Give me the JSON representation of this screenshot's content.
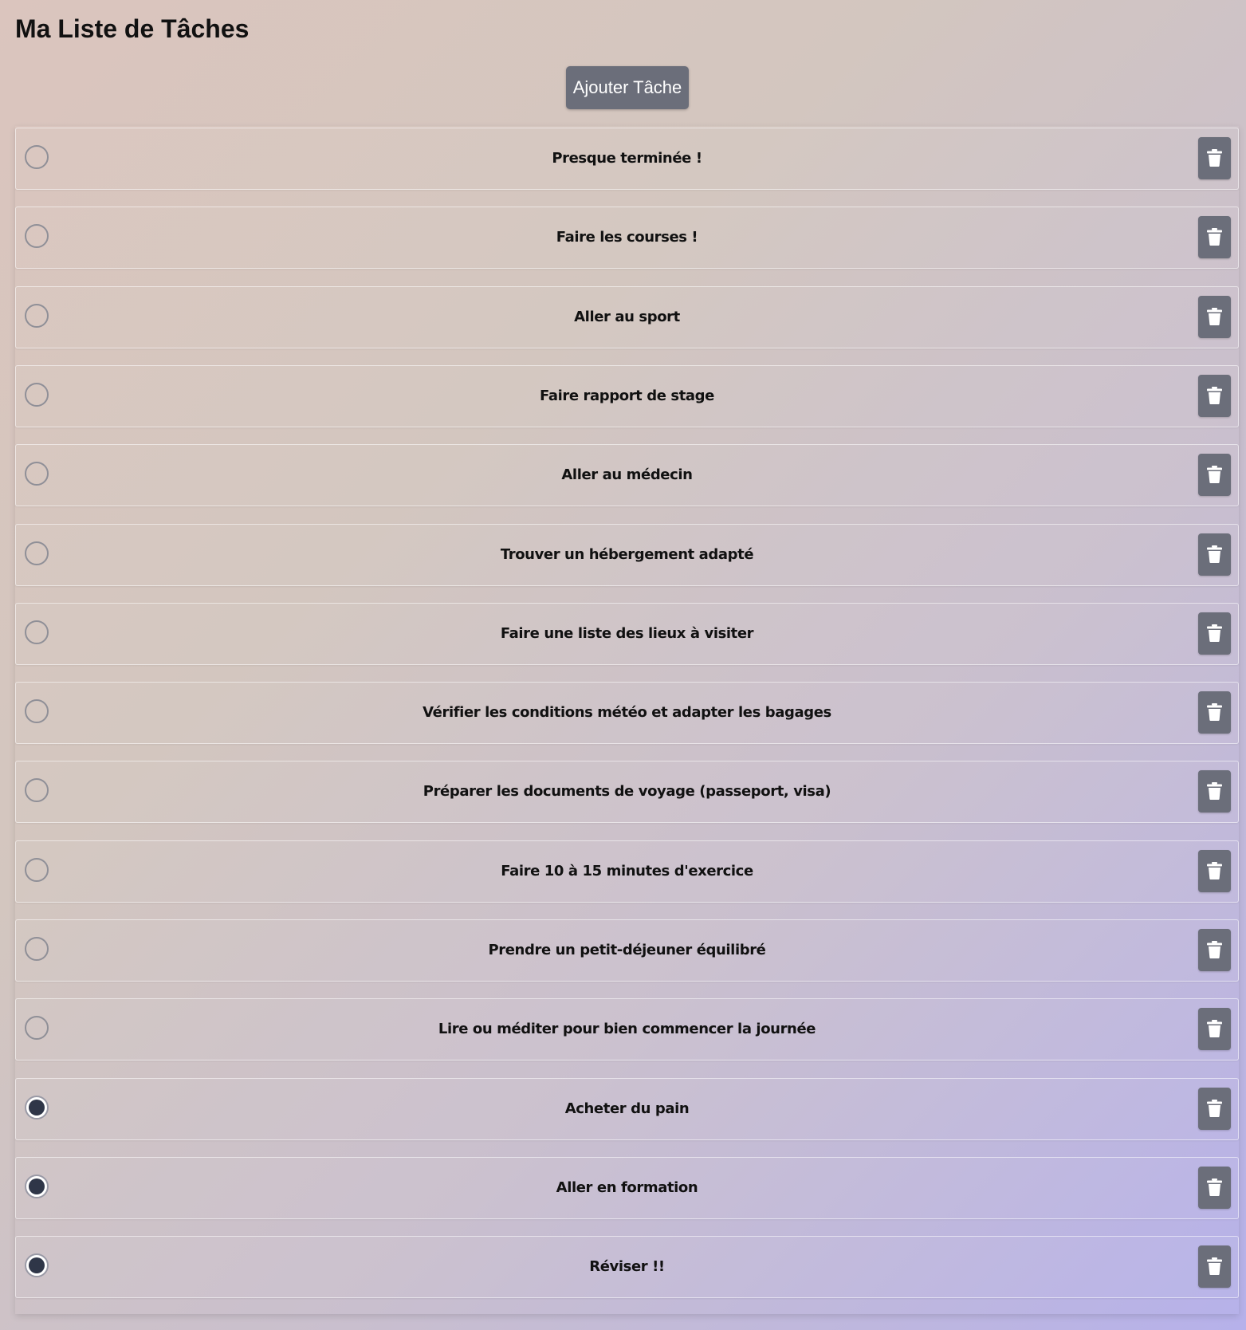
{
  "app": {
    "title": "Ma Liste de Tâches",
    "add_button_label": "Ajouter Tâche"
  },
  "colors": {
    "button": "#6b6e7a",
    "checked_dot": "#2f3648",
    "background_start": "#dbc5be",
    "background_end": "#b6b1ea"
  },
  "tasks": [
    {
      "label": "Presque terminée !",
      "completed": false,
      "delete_icon": "trash-icon"
    },
    {
      "label": "Faire les courses !",
      "completed": false,
      "delete_icon": "trash-icon"
    },
    {
      "label": "Aller au sport",
      "completed": false,
      "delete_icon": "trash-icon"
    },
    {
      "label": "Faire rapport de stage",
      "completed": false,
      "delete_icon": "trash-icon"
    },
    {
      "label": "Aller au médecin",
      "completed": false,
      "delete_icon": "trash-icon"
    },
    {
      "label": "Trouver un hébergement adapté",
      "completed": false,
      "delete_icon": "trash-icon"
    },
    {
      "label": "Faire une liste des lieux à visiter",
      "completed": false,
      "delete_icon": "trash-icon"
    },
    {
      "label": "Vérifier les conditions météo et adapter les bagages",
      "completed": false,
      "delete_icon": "trash-icon"
    },
    {
      "label": "Préparer les documents de voyage (passeport, visa)",
      "completed": false,
      "delete_icon": "trash-icon"
    },
    {
      "label": "Faire 10 à 15 minutes d'exercice",
      "completed": false,
      "delete_icon": "trash-icon"
    },
    {
      "label": "Prendre un petit-déjeuner équilibré",
      "completed": false,
      "delete_icon": "trash-icon"
    },
    {
      "label": "Lire ou méditer pour bien commencer la journée",
      "completed": false,
      "delete_icon": "trash-icon"
    },
    {
      "label": "Acheter du pain",
      "completed": true,
      "delete_icon": "trash-icon"
    },
    {
      "label": "Aller en formation",
      "completed": true,
      "delete_icon": "trash-icon"
    },
    {
      "label": "Réviser !!",
      "completed": true,
      "delete_icon": "trash-icon"
    }
  ]
}
